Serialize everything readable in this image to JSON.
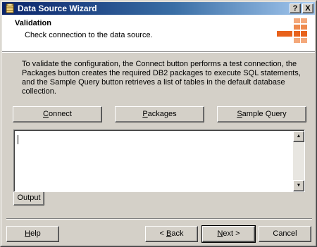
{
  "window": {
    "title": "Data Source Wizard",
    "help_glyph": "?",
    "close_glyph": "X"
  },
  "header": {
    "title": "Validation",
    "subtitle": "Check connection to the data source."
  },
  "description": "To validate the configuration, the Connect button performs a test connection, the Packages button creates the required DB2 packages to execute SQL statements, and the Sample Query button retrieves a list of tables in the default database collection.",
  "actions": {
    "connect": {
      "mnemonic": "C",
      "rest": "onnect"
    },
    "packages": {
      "mnemonic": "P",
      "rest": "ackages"
    },
    "sample_query": {
      "mnemonic": "S",
      "rest": "ample Query"
    }
  },
  "output": {
    "value": "",
    "tab_label": "Output",
    "scroll_up_glyph": "▲",
    "scroll_down_glyph": "▼"
  },
  "footer": {
    "help": {
      "mnemonic": "H",
      "rest": "elp"
    },
    "back": {
      "prefix": "< ",
      "mnemonic": "B",
      "rest": "ack"
    },
    "next": {
      "mnemonic": "N",
      "rest": "ext >"
    },
    "cancel": "Cancel"
  },
  "icons": {
    "app": "data-source-wizard-icon",
    "logo": "ibm-db2-logo"
  },
  "colors": {
    "title_gradient_start": "#0a246a",
    "title_gradient_end": "#a6caf0",
    "logo_orange": "#e8621c",
    "face": "#d4d0c8"
  }
}
